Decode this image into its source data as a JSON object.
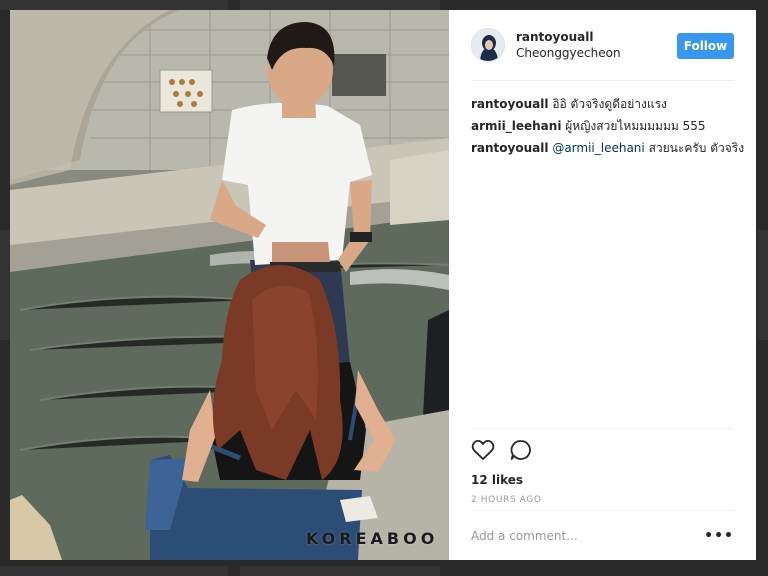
{
  "post": {
    "username": "rantoyouall",
    "location": "Cheonggyecheon",
    "follow_label": "Follow",
    "watermark": "KOREABOO",
    "comments": [
      {
        "user": "rantoyouall",
        "text": "อิอิ ตัวจริงดูดีอย่างแรง"
      },
      {
        "user": "armii_leehani",
        "text": "ผู้หญิงสวยไหมมมมมม 555"
      },
      {
        "user": "rantoyouall",
        "mention": "@armii_leehani",
        "text": "สวยนะครับ ตัวจริง"
      }
    ],
    "likes": "12 likes",
    "time": "2 HOURS AGO",
    "comment_placeholder": "Add a comment...",
    "more_label": "•••"
  },
  "icons": [
    "heart-icon",
    "comment-icon",
    "more-options-icon"
  ],
  "colors": {
    "follow_button": "#3897f0",
    "mention": "#003569",
    "muted_text": "#999999"
  }
}
